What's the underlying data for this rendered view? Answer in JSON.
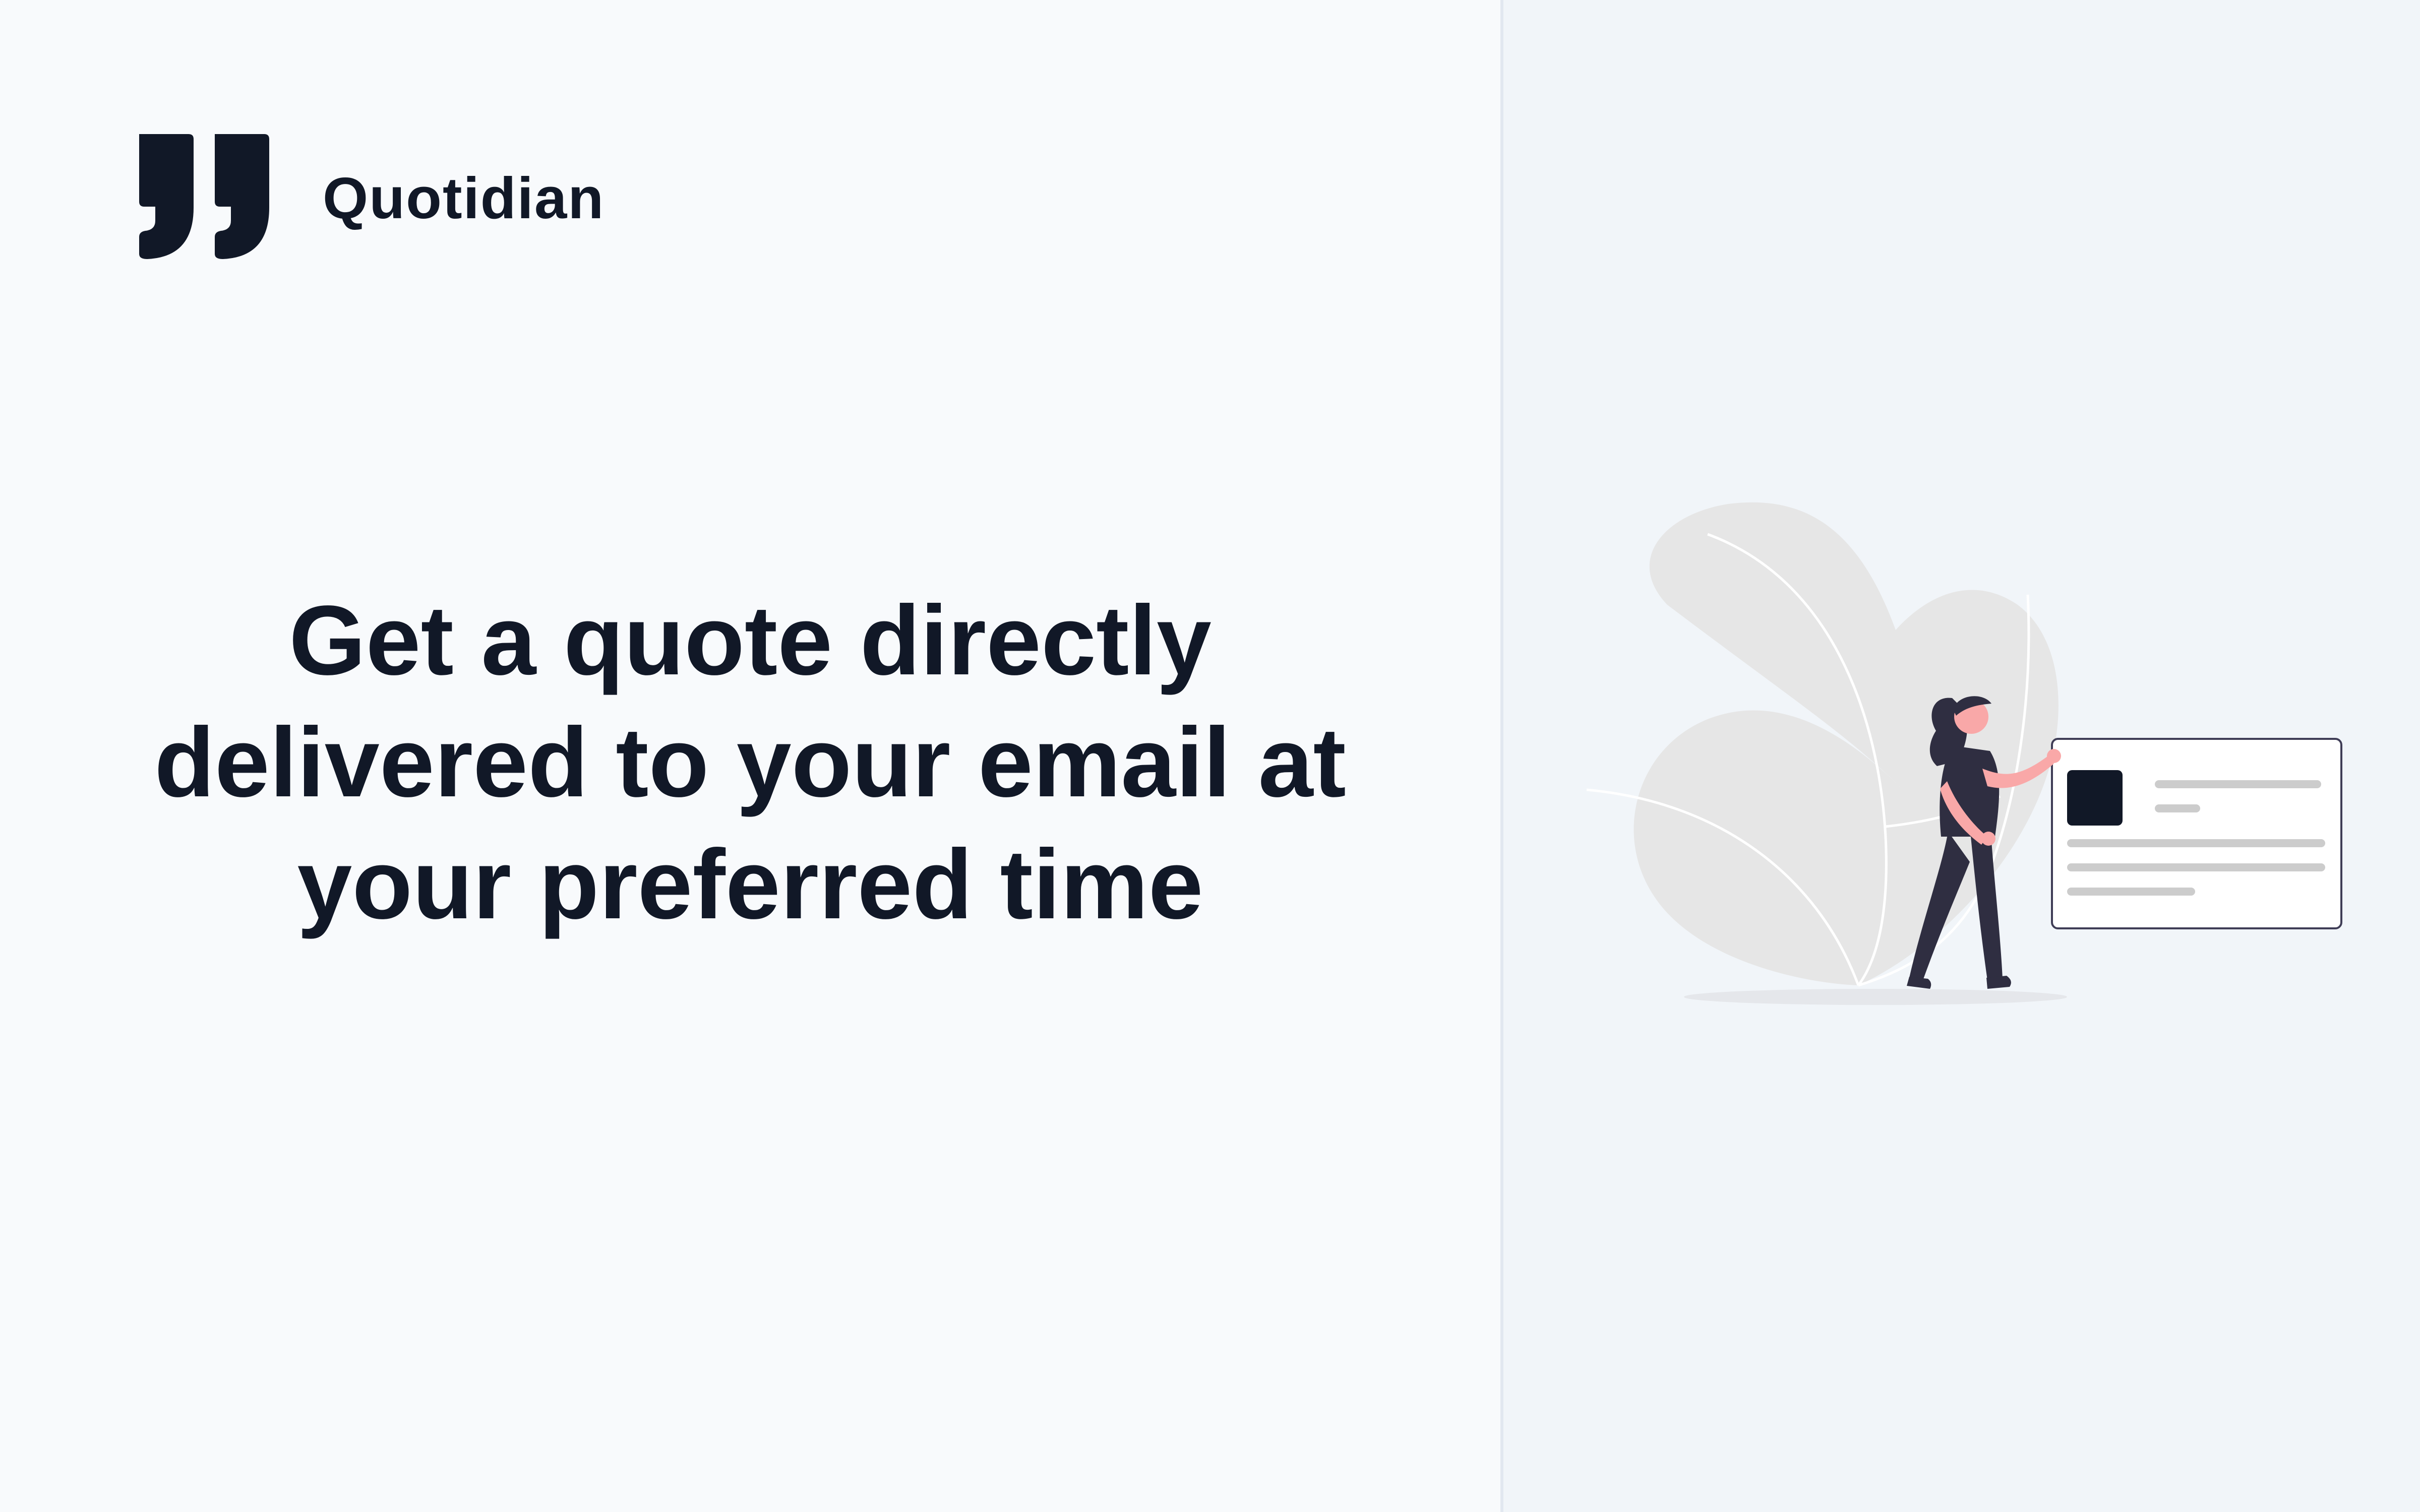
{
  "brand": {
    "name": "Quotidian",
    "logo_icon": "quote-mark-icon"
  },
  "hero": {
    "headline": "Get a quote directly delivered to your email at your preferred time"
  },
  "illustration": {
    "icon": "person-with-card-illustration"
  },
  "colors": {
    "text_primary": "#111827",
    "left_background": "#f8fafc",
    "right_background": "#f1f5f9",
    "accent_skin": "#f9a8a8",
    "leaf_gray": "#e6e6e6"
  }
}
